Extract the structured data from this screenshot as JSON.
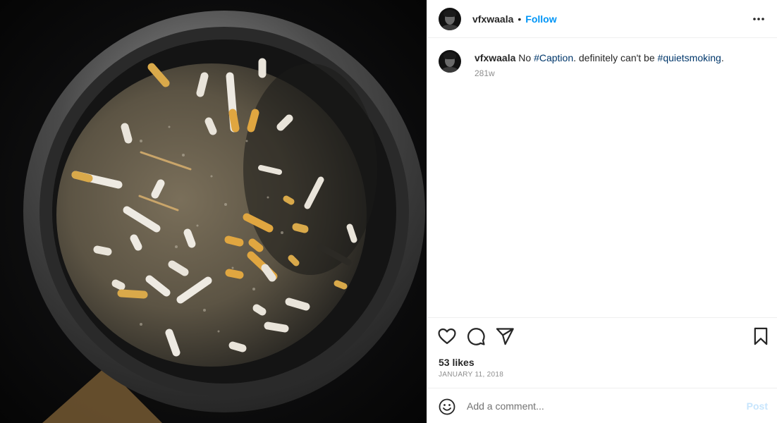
{
  "post": {
    "username": "vfxwaala",
    "separator": "•",
    "follow_label": "Follow",
    "more_label": "More options"
  },
  "caption": {
    "username": "vfxwaala",
    "text_1": "No ",
    "hashtag_1": "#Caption",
    "text_2": ". definitely can't be ",
    "hashtag_2": "#quietsmoking",
    "text_3": ".",
    "time_ago": "281w"
  },
  "actions": {
    "like_icon": "heart-icon",
    "comment_icon": "comment-icon",
    "share_icon": "paper-plane-icon",
    "save_icon": "bookmark-icon"
  },
  "stats": {
    "likes": "53 likes",
    "date": "JANUARY 11, 2018"
  },
  "comment": {
    "placeholder": "Add a comment...",
    "post_label": "Post",
    "emoji_icon": "smiley-icon"
  },
  "colors": {
    "accent": "#0095f6",
    "hashtag": "#00376b",
    "muted": "#8e8e8e",
    "post_disabled": "#c7e5fd"
  }
}
